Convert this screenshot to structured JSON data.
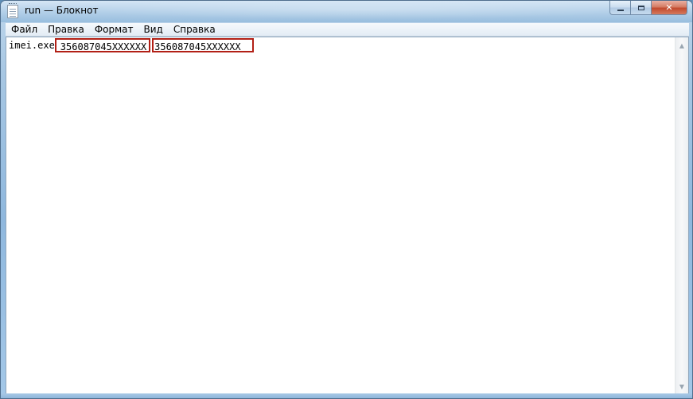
{
  "window": {
    "title": "run — Блокнот"
  },
  "menu": {
    "items": [
      "Файл",
      "Правка",
      "Формат",
      "Вид",
      "Справка"
    ]
  },
  "editor": {
    "line_prefix": "imei.exe",
    "highlight_1": "356087045XXXXXX",
    "highlight_2": "356087045XXXXXX"
  },
  "colors": {
    "highlight_border": "#b22016"
  },
  "icons": {
    "app": "notepad-icon",
    "minimize": "minimize-icon",
    "maximize": "maximize-icon",
    "close": "close-icon",
    "scroll_up": "scroll-up-arrow-icon",
    "scroll_down": "scroll-down-arrow-icon"
  }
}
